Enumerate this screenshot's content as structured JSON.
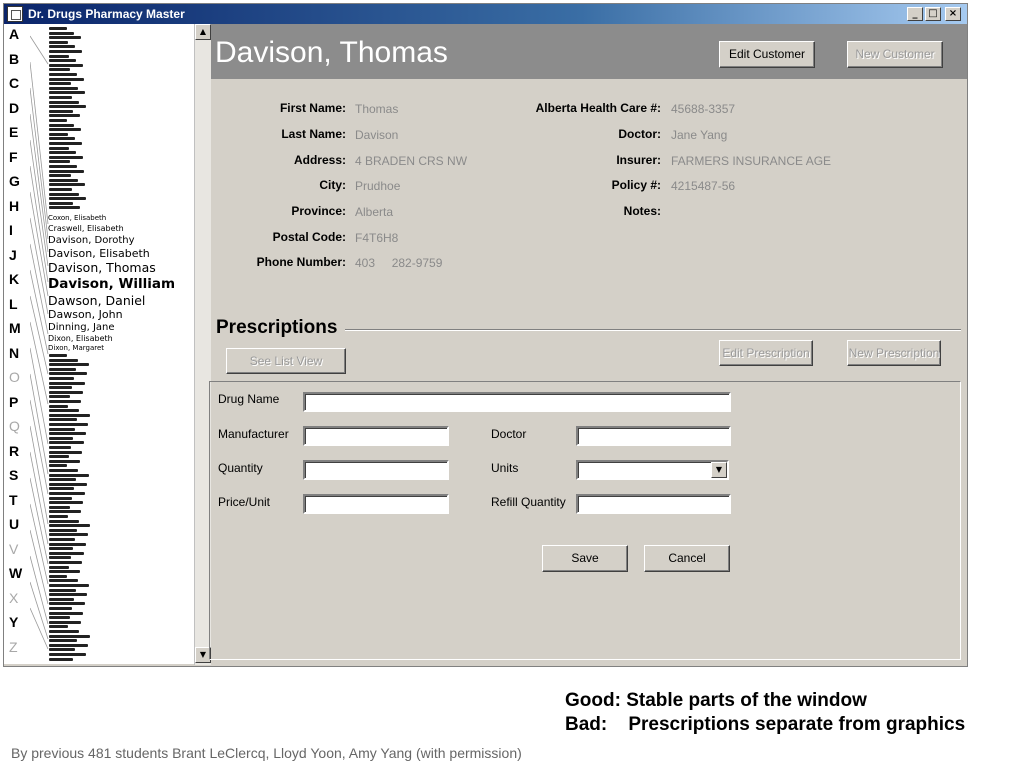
{
  "window": {
    "title": "Dr. Drugs Pharmacy Master",
    "minimize_glyph": "_",
    "maximize_glyph": "□",
    "close_glyph": "×"
  },
  "alphabet": [
    {
      "letter": "A",
      "enabled": true
    },
    {
      "letter": "B",
      "enabled": true
    },
    {
      "letter": "C",
      "enabled": true
    },
    {
      "letter": "D",
      "enabled": true
    },
    {
      "letter": "E",
      "enabled": true
    },
    {
      "letter": "F",
      "enabled": true
    },
    {
      "letter": "G",
      "enabled": true
    },
    {
      "letter": "H",
      "enabled": true
    },
    {
      "letter": "I",
      "enabled": true
    },
    {
      "letter": "J",
      "enabled": true
    },
    {
      "letter": "K",
      "enabled": true
    },
    {
      "letter": "L",
      "enabled": true
    },
    {
      "letter": "M",
      "enabled": true
    },
    {
      "letter": "N",
      "enabled": true
    },
    {
      "letter": "O",
      "enabled": false
    },
    {
      "letter": "P",
      "enabled": true
    },
    {
      "letter": "Q",
      "enabled": false
    },
    {
      "letter": "R",
      "enabled": true
    },
    {
      "letter": "S",
      "enabled": true
    },
    {
      "letter": "T",
      "enabled": true
    },
    {
      "letter": "U",
      "enabled": true
    },
    {
      "letter": "V",
      "enabled": false
    },
    {
      "letter": "W",
      "enabled": true
    },
    {
      "letter": "X",
      "enabled": false
    },
    {
      "letter": "Y",
      "enabled": true
    },
    {
      "letter": "Z",
      "enabled": false
    }
  ],
  "name_list": {
    "readable_names": [
      "Coxon, Elisabeth",
      "Craswell, Elisabeth",
      "Davison, Dorothy",
      "Davison, Elisabeth",
      "Davison, Thomas",
      "Davison, William",
      "Dawson, Daniel",
      "Dawson, John",
      "Dinning, Jane",
      "Dixon, Elisabeth",
      "Dixon, Margaret"
    ],
    "selected_name": "Davison, William"
  },
  "customer": {
    "name": "Davison, Thomas",
    "edit_button": "Edit Customer",
    "new_button": "New Customer",
    "fields_left": [
      {
        "label": "First Name:",
        "value": "Thomas"
      },
      {
        "label": "Last Name:",
        "value": "Davison"
      },
      {
        "label": "Address:",
        "value": "4 BRADEN CRS NW"
      },
      {
        "label": "City:",
        "value": "Prudhoe"
      },
      {
        "label": "Province:",
        "value": "Alberta"
      },
      {
        "label": "Postal Code:",
        "value": "F4T6H8"
      },
      {
        "label": "Phone Number:",
        "value": "403     282-9759"
      }
    ],
    "fields_right": [
      {
        "label": "Alberta Health Care #:",
        "value": "45688-3357"
      },
      {
        "label": "Doctor:",
        "value": "Jane Yang"
      },
      {
        "label": "Insurer:",
        "value": "FARMERS INSURANCE AGE"
      },
      {
        "label": "Policy #:",
        "value": "4215487-56"
      },
      {
        "label": "Notes:",
        "value": ""
      }
    ]
  },
  "prescriptions": {
    "title": "Prescriptions",
    "see_list_button": "See List View",
    "edit_button": "Edit Prescription",
    "new_button": "New Prescription",
    "form": {
      "drug_name_label": "Drug Name",
      "manufacturer_label": "Manufacturer",
      "doctor_label": "Doctor",
      "quantity_label": "Quantity",
      "units_label": "Units",
      "price_label": "Price/Unit",
      "refill_label": "Refill Quantity",
      "drug_name_value": "",
      "manufacturer_value": "",
      "doctor_value": "",
      "quantity_value": "",
      "units_value": "",
      "price_value": "",
      "refill_value": "",
      "save_button": "Save",
      "cancel_button": "Cancel"
    }
  },
  "captions": {
    "good": "Good: Stable parts of the window",
    "bad": "Bad:    Prescriptions separate from graphics",
    "credit": "By previous 481 students Brant LeClercq, Lloyd Yoon, Amy Yang (with permission)"
  },
  "colors": {
    "title_bar": "#0a246a",
    "window_face": "#d4d0c8",
    "header_band": "#8c8c8c",
    "value_text": "#8a8a8a"
  }
}
